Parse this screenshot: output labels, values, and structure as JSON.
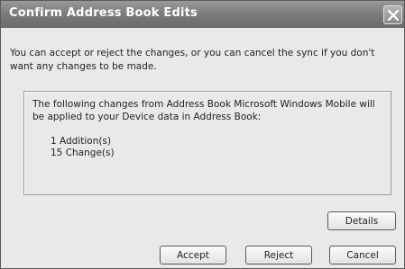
{
  "dialog": {
    "title": "Confirm Address Book Edits",
    "intro": "You can accept or reject the changes, or you can cancel the sync if you don't want any changes to be made.",
    "panel": {
      "message": "The following changes from Address Book Microsoft Windows Mobile will be applied to your Device data in Address Book:",
      "additions": "1 Addition(s)",
      "changes": "15 Change(s)"
    },
    "buttons": {
      "details": "Details",
      "accept": "Accept",
      "reject": "Reject",
      "cancel": "Cancel"
    }
  },
  "icons": {
    "close": "close-icon"
  }
}
